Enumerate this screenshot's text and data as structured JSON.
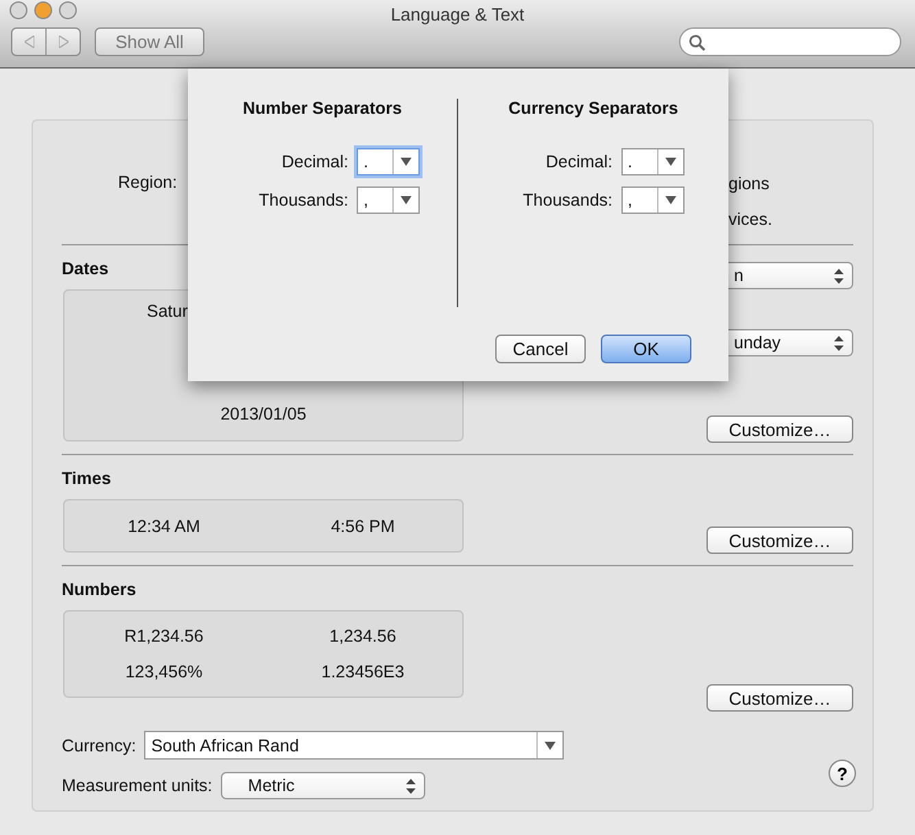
{
  "window": {
    "title": "Language & Text"
  },
  "toolbar": {
    "show_all": "Show All"
  },
  "sheet": {
    "columns": [
      {
        "title": "Number Separators",
        "fields": [
          {
            "label": "Decimal:",
            "value": ".",
            "focused": true
          },
          {
            "label": "Thousands:",
            "value": ",",
            "focused": false
          }
        ]
      },
      {
        "title": "Currency Separators",
        "fields": [
          {
            "label": "Decimal:",
            "value": ".",
            "focused": false
          },
          {
            "label": "Thousands:",
            "value": ",",
            "focused": false
          }
        ]
      }
    ],
    "buttons": [
      {
        "label": "Cancel",
        "default": false
      },
      {
        "label": "OK",
        "default": true
      }
    ]
  },
  "region": {
    "label": "Region:",
    "note_lines": [
      "gions",
      "vices."
    ]
  },
  "dates": {
    "title": "Dates",
    "samples": [
      "Satur",
      "2013/01/05"
    ],
    "popups": [
      {
        "value": "n"
      },
      {
        "value": "unday"
      }
    ],
    "customize": "Customize…"
  },
  "times": {
    "title": "Times",
    "samples": [
      "12:34 AM",
      "4:56 PM"
    ],
    "customize": "Customize…"
  },
  "numbers": {
    "title": "Numbers",
    "samples": [
      "R1,234.56",
      "1,234.56",
      "123,456%",
      "1.23456E3"
    ],
    "customize": "Customize…"
  },
  "currency": {
    "label": "Currency:",
    "value": "South African Rand"
  },
  "measurement": {
    "label": "Measurement units:",
    "value": "Metric"
  },
  "help": "?"
}
